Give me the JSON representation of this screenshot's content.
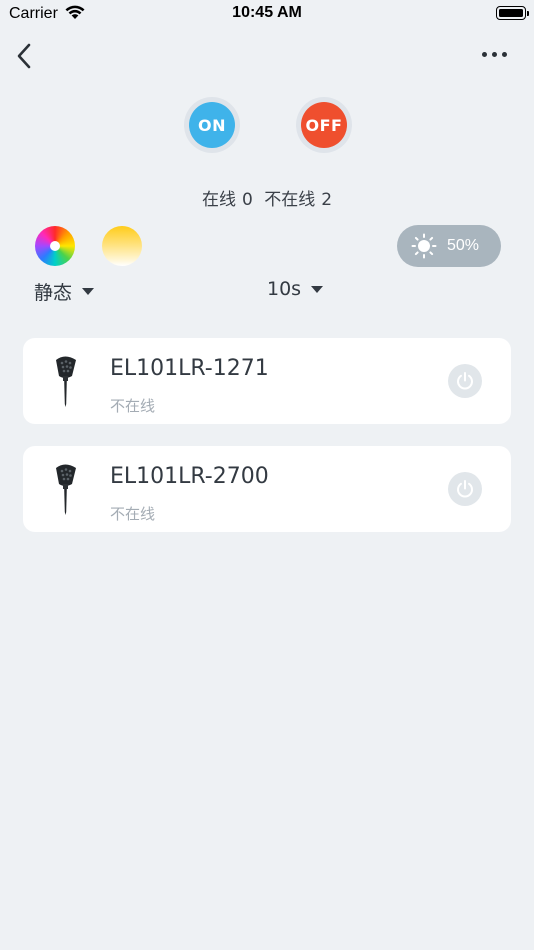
{
  "status_bar": {
    "carrier": "Carrier",
    "time": "10:45 AM"
  },
  "controls": {
    "on_label": "ON",
    "off_label": "OFF",
    "online_label": "在线",
    "online_count": "0",
    "offline_label": "不在线",
    "offline_count": "2",
    "brightness": "50%",
    "mode_selected": "静态",
    "speed_selected": "10s"
  },
  "devices": [
    {
      "name": "EL101LR-1271",
      "status": "不在线"
    },
    {
      "name": "EL101LR-2700",
      "status": "不在线"
    }
  ],
  "colors": {
    "on": "#3fb3ea",
    "off": "#ef4f2e",
    "background": "#eef1f4",
    "brightness_pill": "#a9b5be"
  },
  "icons": [
    "wifi-icon",
    "battery-icon",
    "back-chevron-icon",
    "more-dots-icon",
    "sun-icon",
    "caret-down-icon",
    "spotlight-lamp-icon",
    "power-icon"
  ]
}
